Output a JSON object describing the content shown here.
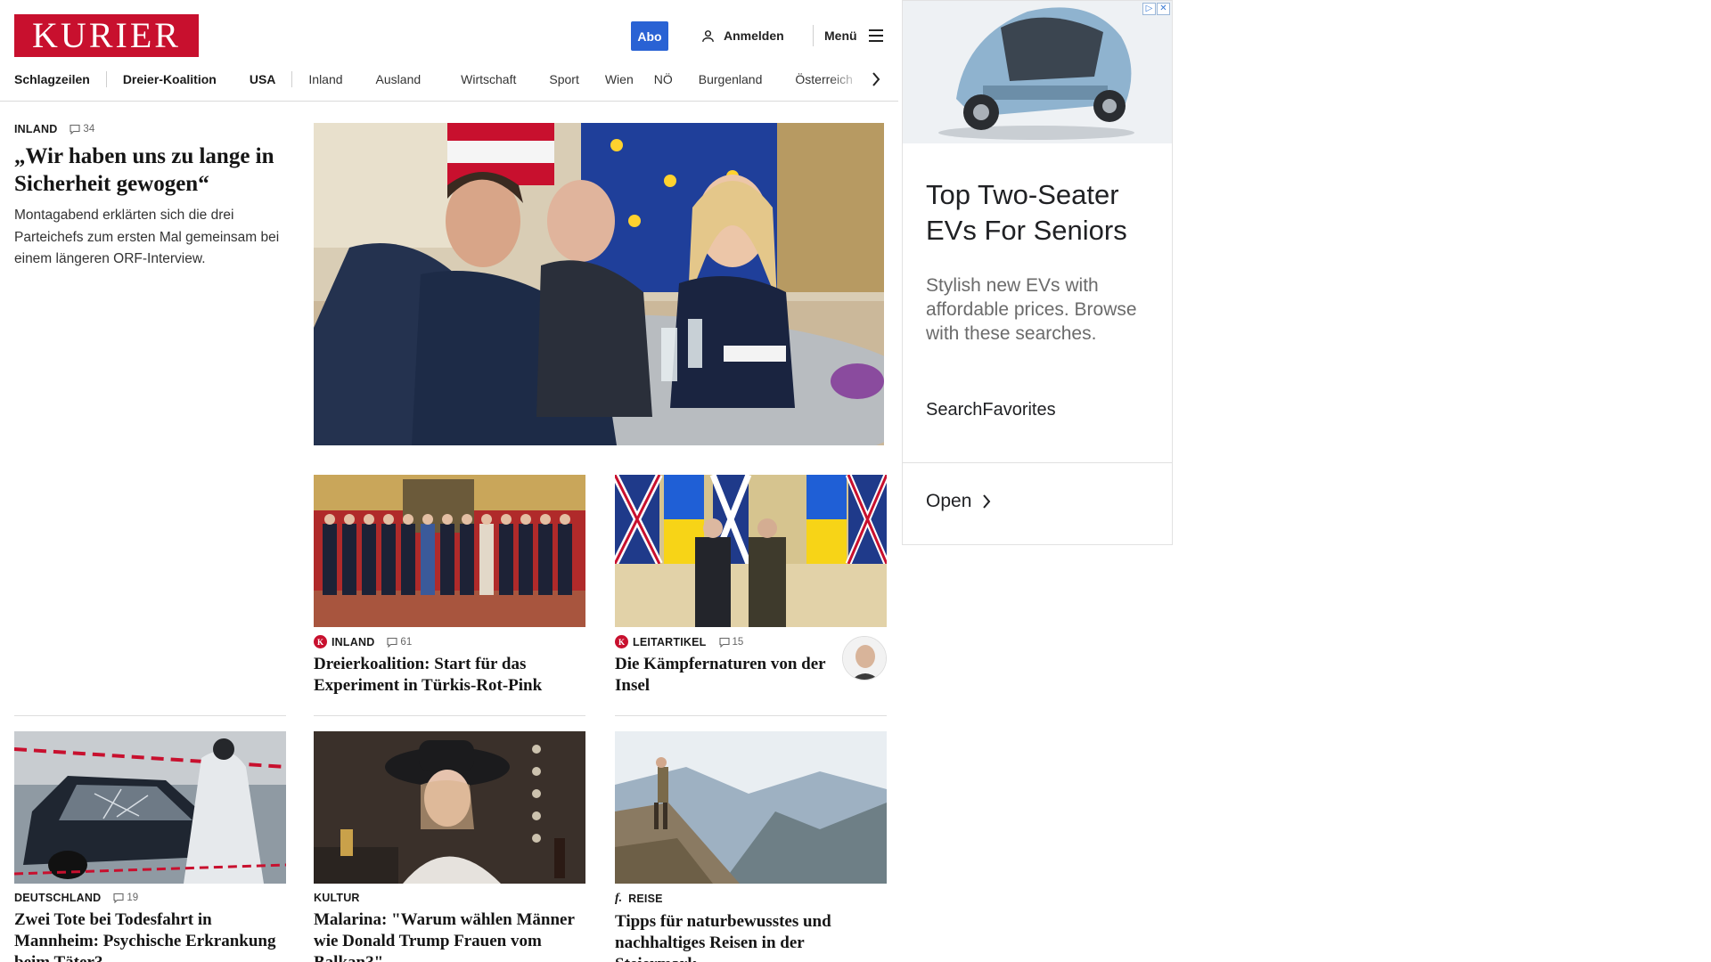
{
  "header": {
    "logo_text": "KURIER",
    "abo_label": "Abo",
    "login_label": "Anmelden",
    "menu_label": "Menü"
  },
  "nav": {
    "items": [
      "Schlagzeilen",
      "Dreier-Koalition",
      "USA",
      "Inland",
      "Ausland",
      "Wirtschaft",
      "Sport",
      "Wien",
      "NÖ",
      "Burgenland",
      "Österreich"
    ]
  },
  "lead": {
    "kicker": "INLAND",
    "comments": "34",
    "headline": "„Wir haben uns zu lange in Sicherheit gewogen“",
    "teaser": "Montagabend erklärten sich die drei Parteichefs zum ersten Mal gemeinsam bei einem längeren ORF-Interview."
  },
  "articles": [
    {
      "kicker": "INLAND",
      "comments": "61",
      "badge": "K",
      "headline": "Dreierkoalition: Start für das Experiment in Türkis-Rot-Pink"
    },
    {
      "kicker": "LEITARTIKEL",
      "comments": "15",
      "badge": "K",
      "headline": "Die Kämpfernaturen von der Insel"
    },
    {
      "kicker": "DEUTSCHLAND",
      "comments": "19",
      "headline": "Zwei Tote bei Todesfahrt in Mannheim: Psychische Erkrankung beim Täter?"
    },
    {
      "kicker": "KULTUR",
      "headline": "Malarina: \"Warum wählen Männer wie Donald Trump Frauen vom Balkan?\""
    },
    {
      "kicker": "REISE",
      "badge": "f.",
      "headline": "Tipps für naturbewusstes und nachhaltiges Reisen in der Steiermark"
    }
  ],
  "ad": {
    "title": "Top Two-Seater EVs For Seniors",
    "description": "Stylish new EVs with affordable prices. Browse with these searches.",
    "brand": "SearchFavorites",
    "cta": "Open"
  },
  "colors": {
    "brand_red": "#c8102e",
    "abo_blue": "#2962d4"
  }
}
